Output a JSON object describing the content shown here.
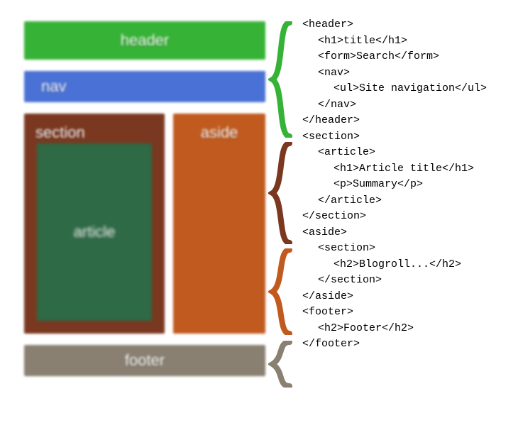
{
  "layout": {
    "header": "header",
    "nav": "nav",
    "section": "section",
    "article": "article",
    "aside": "aside",
    "footer": "footer"
  },
  "braces": {
    "colors": [
      "#36b336",
      "#7a3820",
      "#c15a1e",
      "#8a8071"
    ]
  },
  "code": {
    "lines": [
      [
        "",
        "<header>"
      ],
      [
        "i1",
        "<h1>title</h1>"
      ],
      [
        "i1",
        "<form>Search</form>"
      ],
      [
        "i1",
        "<nav>"
      ],
      [
        "i2",
        "<ul>Site navigation</ul>"
      ],
      [
        "i1",
        "</nav>"
      ],
      [
        "",
        "</header>"
      ],
      [
        "",
        "<section>"
      ],
      [
        "i1",
        "<article>"
      ],
      [
        "i2",
        "<h1>Article title</h1>"
      ],
      [
        "i2",
        "<p>Summary</p>"
      ],
      [
        "i1",
        "</article>"
      ],
      [
        "",
        "</section>"
      ],
      [
        "",
        "<aside>"
      ],
      [
        "i1",
        "<section>"
      ],
      [
        "i2",
        "<h2>Blogroll...</h2>"
      ],
      [
        "i1",
        "</section>"
      ],
      [
        "",
        "</aside>"
      ],
      [
        "",
        "<footer>"
      ],
      [
        "i1",
        "<h2>Footer</h2>"
      ],
      [
        "",
        "</footer>"
      ]
    ]
  }
}
